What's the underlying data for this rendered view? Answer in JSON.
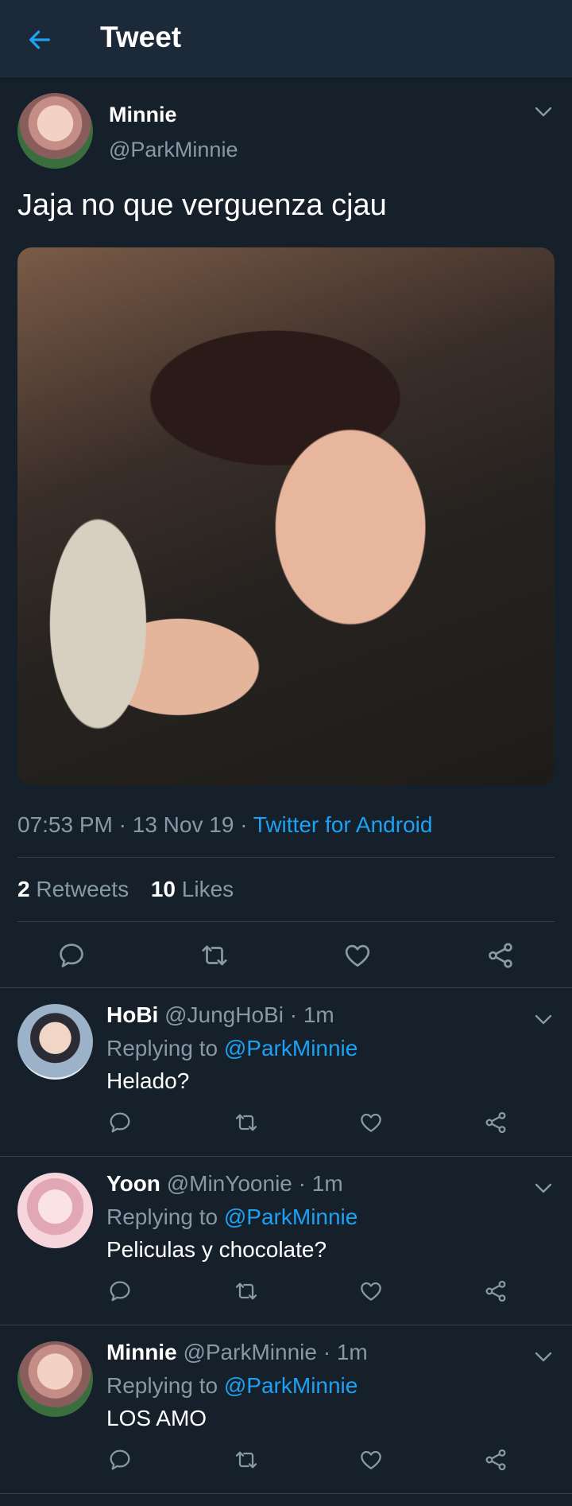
{
  "header": {
    "title": "Tweet",
    "back_icon": "arrow-left-icon"
  },
  "colors": {
    "background": "#15202b",
    "header_bg": "#1c2938",
    "accent": "#1da1f2",
    "muted": "#8899a6",
    "divider": "#38444d"
  },
  "tweet": {
    "author_name": "Minnie",
    "author_handle": "@ParkMinnie",
    "text": "Jaja no que verguenza cjau",
    "time": "07:53 PM",
    "date": "13 Nov 19",
    "client": "Twitter for Android",
    "separator": " · ",
    "retweets_count": "2",
    "retweets_label": "Retweets",
    "likes_count": "10",
    "likes_label": "Likes"
  },
  "replies": [
    {
      "name": "HoBi",
      "handle": "@JungHoBi",
      "time": "1m",
      "replying_label": "Replying to",
      "mention": "@ParkMinnie",
      "text": "Helado?"
    },
    {
      "name": "Yoon",
      "handle": "@MinYoonie",
      "time": "1m",
      "replying_label": "Replying to",
      "mention": "@ParkMinnie",
      "text": "Peliculas y chocolate?"
    },
    {
      "name": "Minnie",
      "handle": "@ParkMinnie",
      "time": "1m",
      "replying_label": "Replying to",
      "mention": "@ParkMinnie",
      "text": "LOS AMO"
    }
  ]
}
